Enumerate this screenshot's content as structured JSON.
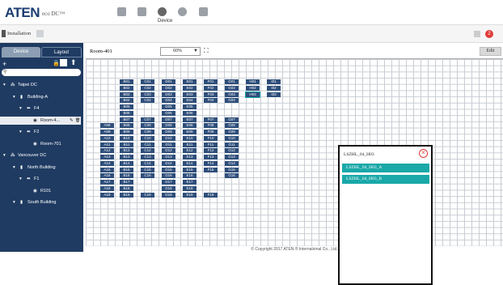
{
  "header": {
    "logo": "ATEN",
    "product": "eco DC™",
    "active_nav": "Device",
    "icons": [
      "monitor-icon",
      "user-icon",
      "device-icon",
      "gear-icon",
      "document-icon"
    ]
  },
  "subheader": {
    "title": "Installation",
    "badge_count": "2"
  },
  "sidebar": {
    "tabs": [
      "Device",
      "Layout"
    ],
    "tree": [
      {
        "label": "Taipei DC",
        "icon": "datacenter-icon",
        "level": 0
      },
      {
        "label": "Building-A",
        "icon": "building-icon",
        "level": 1
      },
      {
        "label": "F4",
        "icon": "floor-icon",
        "level": 2
      },
      {
        "label": "Room-4...",
        "icon": "room-icon",
        "level": 3,
        "selected": true
      },
      {
        "label": "F2",
        "icon": "floor-icon",
        "level": 2
      },
      {
        "label": "Room-701",
        "icon": "room-icon",
        "level": 3
      },
      {
        "label": "Vancouver DC",
        "icon": "datacenter-icon",
        "level": 0
      },
      {
        "label": "North Building",
        "icon": "building-icon",
        "level": 1
      },
      {
        "label": "F1",
        "icon": "floor-icon",
        "level": 2
      },
      {
        "label": "R101",
        "icon": "room-icon",
        "level": 3
      },
      {
        "label": "South Building",
        "icon": "building-icon",
        "level": 1
      }
    ]
  },
  "content": {
    "room": "Room-401",
    "zoom": "60%",
    "edit_label": "Edit",
    "racks": [
      [
        "B01",
        "C01",
        "D01",
        "E01",
        "F01",
        "G01",
        "H01",
        "I01"
      ],
      [
        "B02",
        "C02",
        "D02",
        "E02",
        "F02",
        "G02",
        "H02",
        "I02"
      ],
      [
        "B03",
        "C03",
        "D03",
        "E03",
        "F03",
        "G03",
        "H03",
        "I03"
      ],
      [
        "B04",
        "C04",
        "D04",
        "E04",
        "F04",
        "G04"
      ],
      [
        "B05",
        "D05",
        "E05"
      ],
      [
        "B06",
        "D06",
        "E06"
      ],
      [
        "B07",
        "C07",
        "D07",
        "E07",
        "F07",
        "G07"
      ],
      [
        "A08",
        "B08",
        "C08",
        "D08",
        "E08",
        "F08",
        "G08"
      ],
      [
        "A09",
        "B09",
        "C09",
        "D09",
        "E09",
        "F09",
        "G09"
      ],
      [
        "A10",
        "B10",
        "C10",
        "D10",
        "E10",
        "F10",
        "G10"
      ],
      [
        "A11",
        "B11",
        "C11",
        "D11",
        "E11",
        "F11",
        "G11"
      ],
      [
        "A12",
        "B12",
        "C12",
        "D12",
        "E12",
        "F12",
        "G12"
      ],
      [
        "A13",
        "B13",
        "C13",
        "D13",
        "E13",
        "F13",
        "G13"
      ],
      [
        "A14",
        "B14",
        "C14",
        "D14",
        "E14",
        "F14",
        "G14"
      ],
      [
        "A15",
        "B15",
        "C15",
        "D15",
        "E15",
        "F15",
        "G15"
      ],
      [
        "A16",
        "B16",
        "C16",
        "D16",
        "E16",
        "G16"
      ],
      [
        "A17",
        "B17",
        "D17",
        "E17"
      ],
      [
        "A18",
        "B18",
        "D18",
        "E18"
      ],
      [
        "A19",
        "B19",
        "C19",
        "D19",
        "E19",
        "F19"
      ]
    ]
  },
  "popup": {
    "title": "LSZHL_04_H03",
    "items": [
      "LSZHL_04_H03_A",
      "LSZHL_04_H03_B"
    ]
  },
  "footer": {
    "copyright": "© Copyright 2017 ATEN ® International Co., Ltd."
  }
}
